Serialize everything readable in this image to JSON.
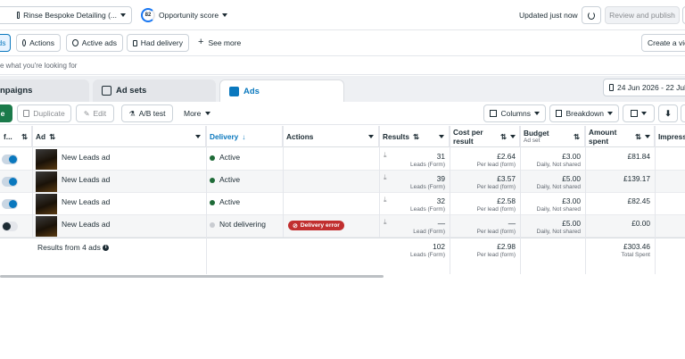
{
  "topbar": {
    "account_name": "Rinse Bespoke Detailing (...",
    "opportunity_score_value": "82",
    "opportunity_score_label": "Opportunity score",
    "updated_text": "Updated just now",
    "review_publish_label": "Review and publish"
  },
  "filters": {
    "ads_partial": "ds",
    "actions": "Actions",
    "active_ads": "Active ads",
    "had_delivery": "Had delivery",
    "see_more": "See more",
    "create_view": "Create a vie"
  },
  "search": {
    "placeholder_partial": "e what you're looking for"
  },
  "tabs": {
    "campaigns": "npaigns",
    "ad_sets": "Ad sets",
    "ads": "Ads",
    "date_range": "24 Jun 2026 - 22 Jul"
  },
  "toolbar": {
    "create_partial": "e",
    "duplicate": "Duplicate",
    "edit": "Edit",
    "ab_test": "A/B test",
    "more": "More",
    "columns": "Columns",
    "breakdown": "Breakdown"
  },
  "columns": {
    "off_on": "f...",
    "ad": "Ad",
    "delivery": "Delivery",
    "actions": "Actions",
    "results": "Results",
    "cost_per_result": "Cost per result",
    "budget": "Budget",
    "budget_sub": "Ad set",
    "amount_spent": "Amount spent",
    "impressions": "Impressi"
  },
  "rows": [
    {
      "name": "New Leads ad",
      "delivery": "Active",
      "status": "active",
      "results": "31",
      "results_sub": "Leads (Form)",
      "cost": "£2.64",
      "cost_sub": "Per lead (form)",
      "budget": "£3.00",
      "budget_sub": "Daily, Not shared",
      "spent": "£81.84"
    },
    {
      "name": "New Leads ad",
      "delivery": "Active",
      "status": "active",
      "results": "39",
      "results_sub": "Leads (Form)",
      "cost": "£3.57",
      "cost_sub": "Per lead (form)",
      "budget": "£5.00",
      "budget_sub": "Daily, Not shared",
      "spent": "£139.17"
    },
    {
      "name": "New Leads ad",
      "delivery": "Active",
      "status": "active",
      "results": "32",
      "results_sub": "Leads (Form)",
      "cost": "£2.58",
      "cost_sub": "Per lead (form)",
      "budget": "£3.00",
      "budget_sub": "Daily, Not shared",
      "spent": "£82.45"
    },
    {
      "name": "New Leads ad",
      "delivery": "Not delivering",
      "status": "inactive",
      "action_badge": "Delivery error",
      "results": "—",
      "results_sub": "Lead (Form)",
      "cost": "—",
      "cost_sub": "Per lead (form)",
      "budget": "£5.00",
      "budget_sub": "Daily, Not shared",
      "spent": "£0.00"
    }
  ],
  "summary": {
    "label": "Results from 4 ads",
    "results": "102",
    "results_sub": "Leads (Form)",
    "cost": "£2.98",
    "cost_sub": "Per lead (form)",
    "spent": "£303.46",
    "spent_sub": "Total Spent"
  },
  "colors": {
    "accent_blue": "#0a78be",
    "active_green": "#31a24c",
    "error_red": "#c12f2f",
    "create_green": "#1b7a4a"
  }
}
